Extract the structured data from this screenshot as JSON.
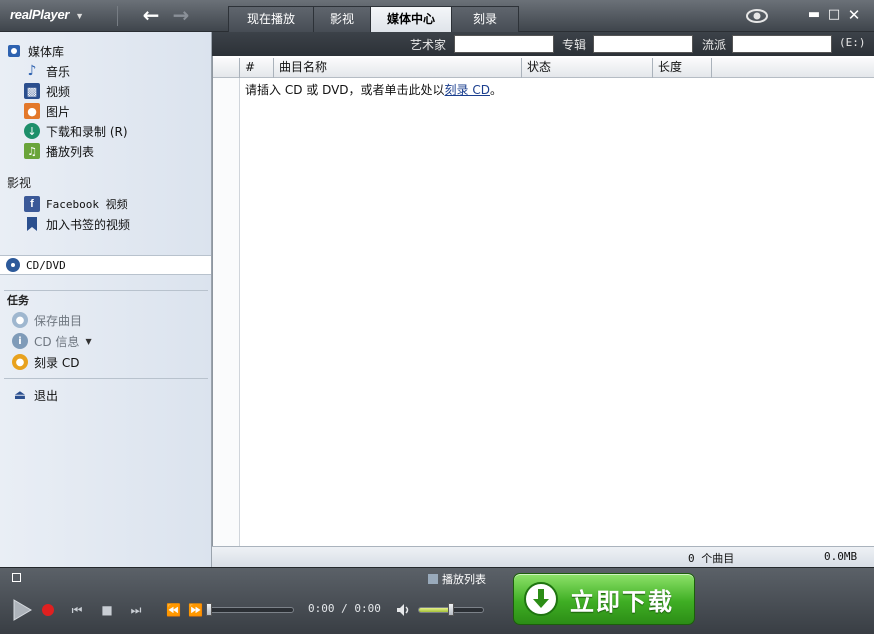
{
  "titlebar": {
    "logo": "realPlayer",
    "tabs": [
      {
        "label": "现在播放"
      },
      {
        "label": "影视"
      },
      {
        "label": "媒体中心"
      },
      {
        "label": "刻录"
      }
    ],
    "active_tab": "媒体中心"
  },
  "sidebar": {
    "library_label": "媒体库",
    "library_items": [
      {
        "label": "音乐",
        "icon": "music-note-icon"
      },
      {
        "label": "视频",
        "icon": "film-icon"
      },
      {
        "label": "图片",
        "icon": "camera-icon"
      },
      {
        "label": "下载和录制 (R)",
        "icon": "download-icon"
      },
      {
        "label": "播放列表",
        "icon": "playlist-icon"
      }
    ],
    "video_label": "影视",
    "video_items": [
      {
        "label": "Facebook 视频",
        "icon": "facebook-icon"
      },
      {
        "label": "加入书签的视频",
        "icon": "bookmark-icon"
      }
    ],
    "cd_label": "CD/DVD",
    "tasks_label": "任务",
    "task_items": [
      {
        "label": "保存曲目"
      },
      {
        "label": "CD 信息"
      },
      {
        "label": "刻录 CD"
      }
    ],
    "exit_label": "退出"
  },
  "search": {
    "artist_label": "艺术家",
    "album_label": "专辑",
    "genre_label": "流派",
    "drive_label": "(E:)"
  },
  "table": {
    "columns": [
      "#",
      "曲目名称",
      "状态",
      "长度"
    ],
    "empty_message_prefix": "请插入 CD 或 DVD，或者单击此处以",
    "empty_message_link": "刻录 CD",
    "empty_message_suffix": "。"
  },
  "status": {
    "track_count": "0 个曲目",
    "size": "0.0MB"
  },
  "player": {
    "playlist_label": "播放列表",
    "time": "0:00 / 0:00",
    "volume_level": 0.5,
    "download_label": "立即下载"
  },
  "colors": {
    "download_green": "#3fae24",
    "active_tab": "#f4f6f9",
    "record_red": "#e02020"
  }
}
